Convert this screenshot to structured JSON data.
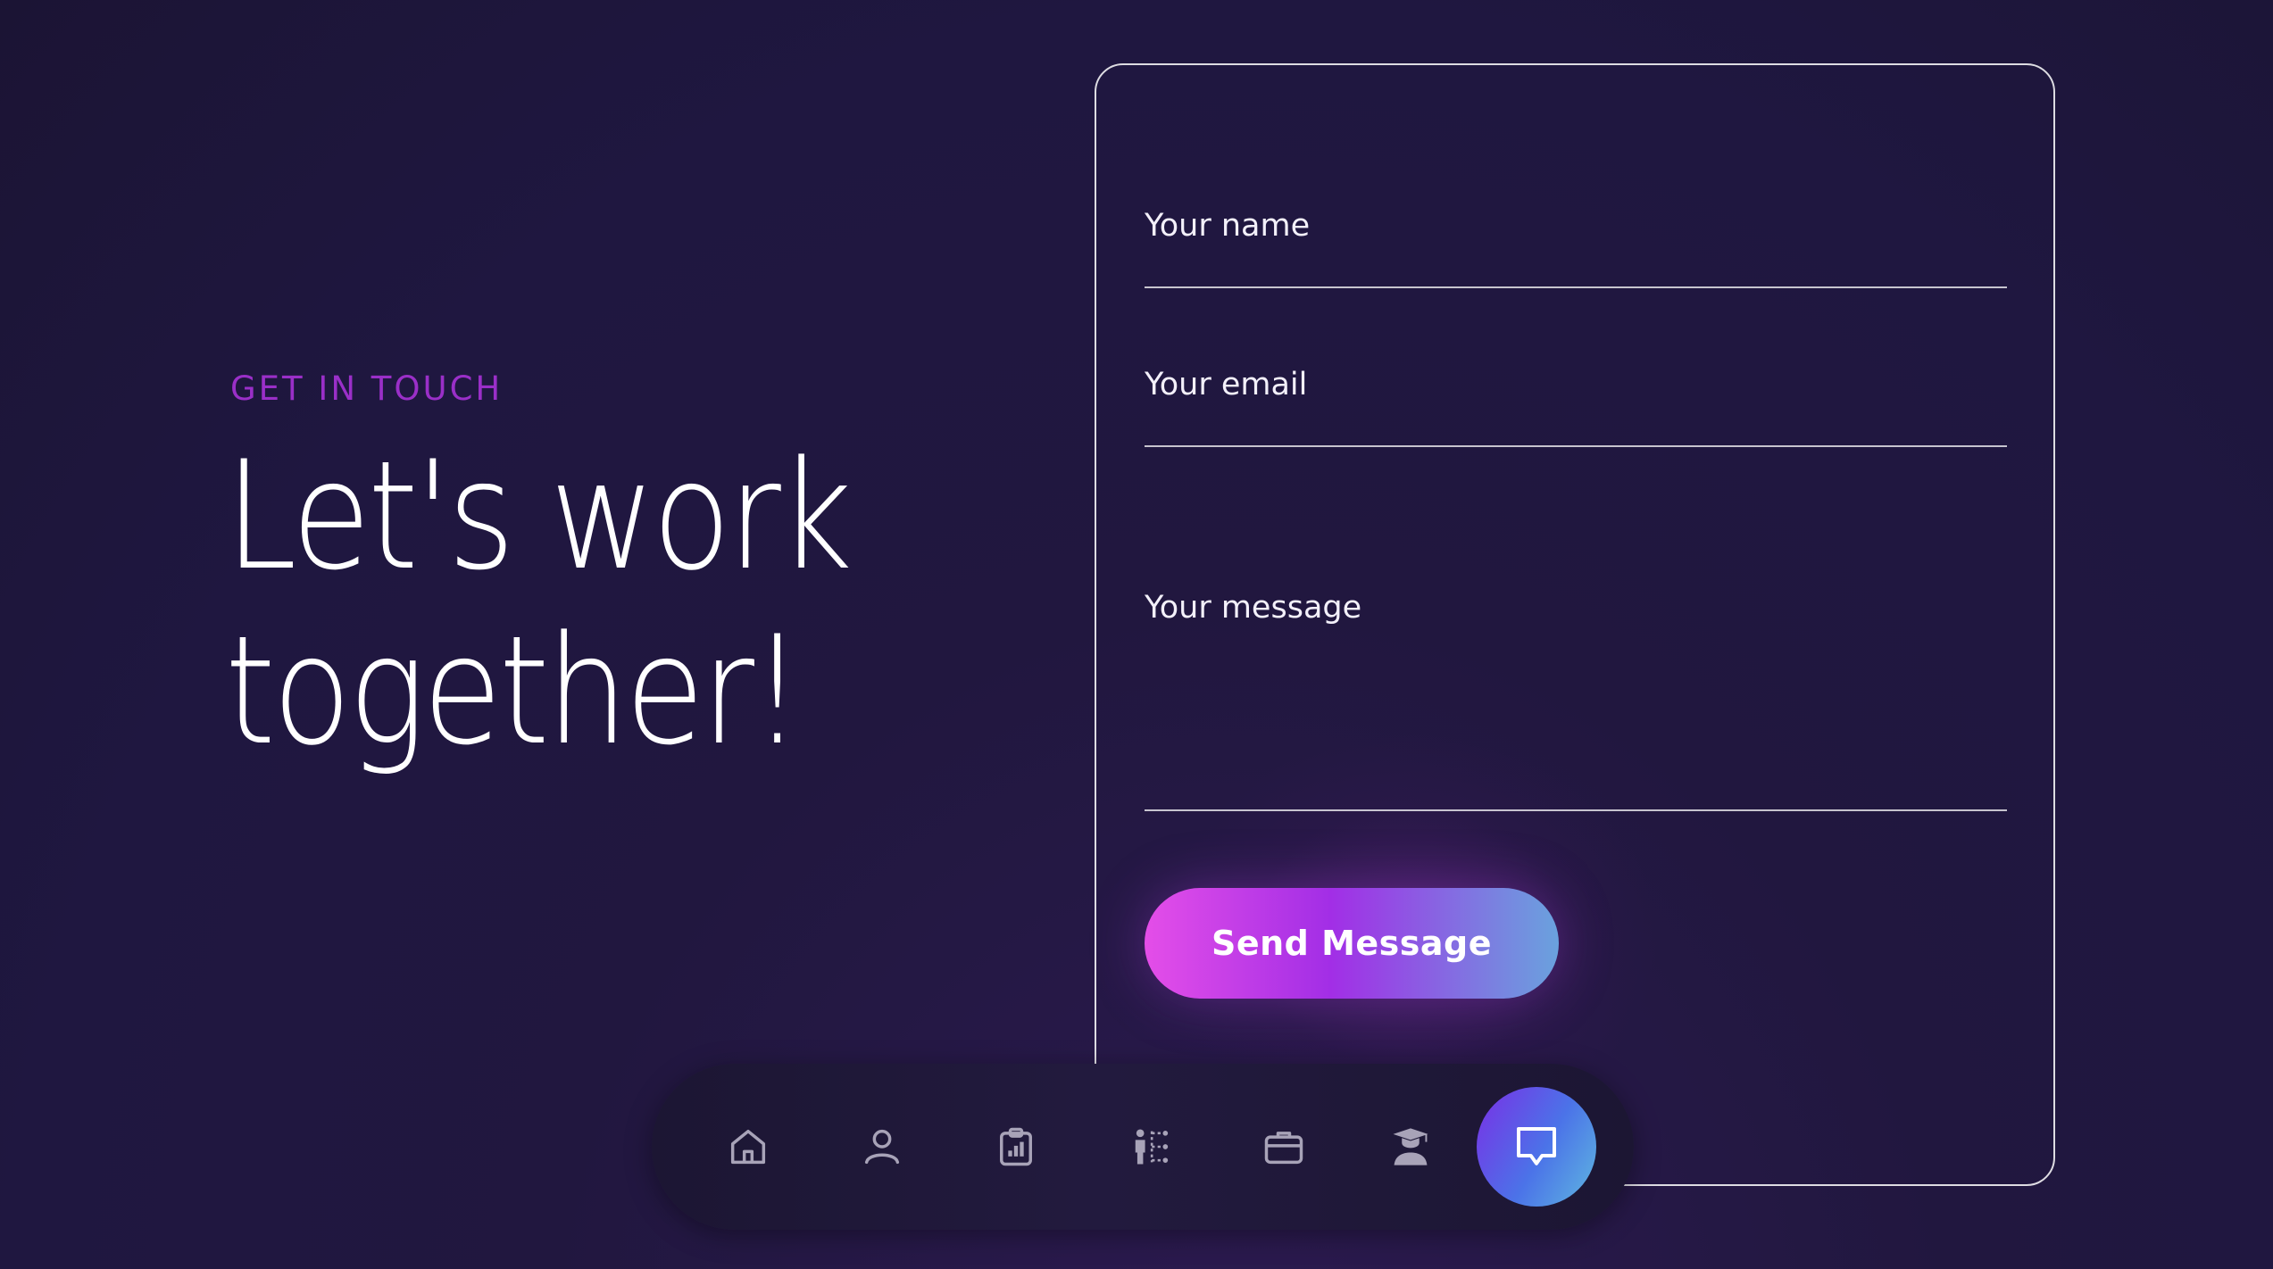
{
  "contact": {
    "eyebrow": "GET IN TOUCH",
    "headline_line1": "Let's work",
    "headline_line2": "together!"
  },
  "form": {
    "name_placeholder": "Your name",
    "email_placeholder": "Your email",
    "message_placeholder": "Your message",
    "submit_label": "Send Message"
  },
  "nav": {
    "items": [
      {
        "icon": "home-icon"
      },
      {
        "icon": "user-icon"
      },
      {
        "icon": "stats-clipboard-icon"
      },
      {
        "icon": "skills-diagram-icon"
      },
      {
        "icon": "briefcase-icon"
      },
      {
        "icon": "graduate-icon"
      },
      {
        "icon": "message-icon",
        "active": true
      }
    ]
  },
  "colors": {
    "background": "#1f1740",
    "eyebrow": "#9a2fc8",
    "button_gradient_start": "#e44ee8",
    "button_gradient_mid": "#a22ee6",
    "button_gradient_end": "#6aa2de",
    "nav_active_start": "#7a2fe6",
    "nav_active_end": "#5fb8e0"
  }
}
